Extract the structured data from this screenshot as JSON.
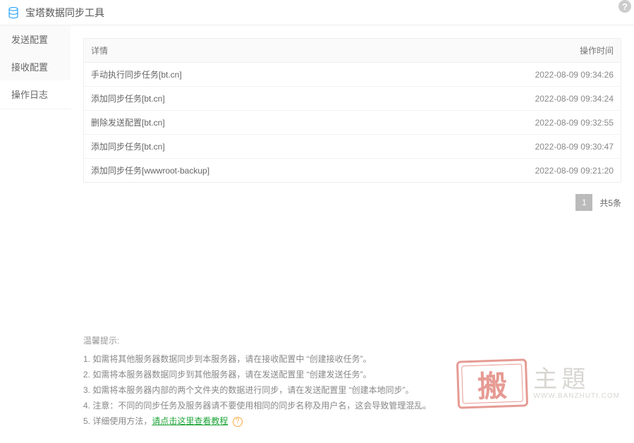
{
  "header": {
    "title": "宝塔数据同步工具"
  },
  "sidebar": {
    "items": [
      {
        "label": "发送配置"
      },
      {
        "label": "接收配置"
      },
      {
        "label": "操作日志"
      }
    ],
    "activeIndex": 2
  },
  "table": {
    "headers": {
      "detail": "详情",
      "time": "操作时间"
    },
    "rows": [
      {
        "detail": "手动执行同步任务[bt.cn]",
        "time": "2022-08-09 09:34:26"
      },
      {
        "detail": "添加同步任务[bt.cn]",
        "time": "2022-08-09 09:34:24"
      },
      {
        "detail": "删除发送配置[bt.cn]",
        "time": "2022-08-09 09:32:55"
      },
      {
        "detail": "添加同步任务[bt.cn]",
        "time": "2022-08-09 09:30:47"
      },
      {
        "detail": "添加同步任务[wwwroot-backup]",
        "time": "2022-08-09 09:21:20"
      }
    ]
  },
  "pagination": {
    "page": "1",
    "total": "共5条"
  },
  "hints": {
    "title": "温馨提示:",
    "items": [
      "1. 如需将其他服务器数据同步到本服务器，请在接收配置中 “创建接收任务”。",
      "2. 如需将本服务器数据同步到其他服务器，请在发送配置里 “创建发送任务”。",
      "3. 如需将本服务器内部的两个文件夹的数据进行同步，请在发送配置里 “创建本地同步”。",
      "4. 注意：不同的同步任务及服务器请不要使用相同的同步名称及用户名，这会导致管理混乱。"
    ],
    "link_prefix": "5. 详细使用方法，",
    "link_text": "请点击这里查看教程"
  },
  "watermark": {
    "stamp": "搬",
    "text": "主題",
    "url": "WWW.BANZHUTI.COM"
  }
}
